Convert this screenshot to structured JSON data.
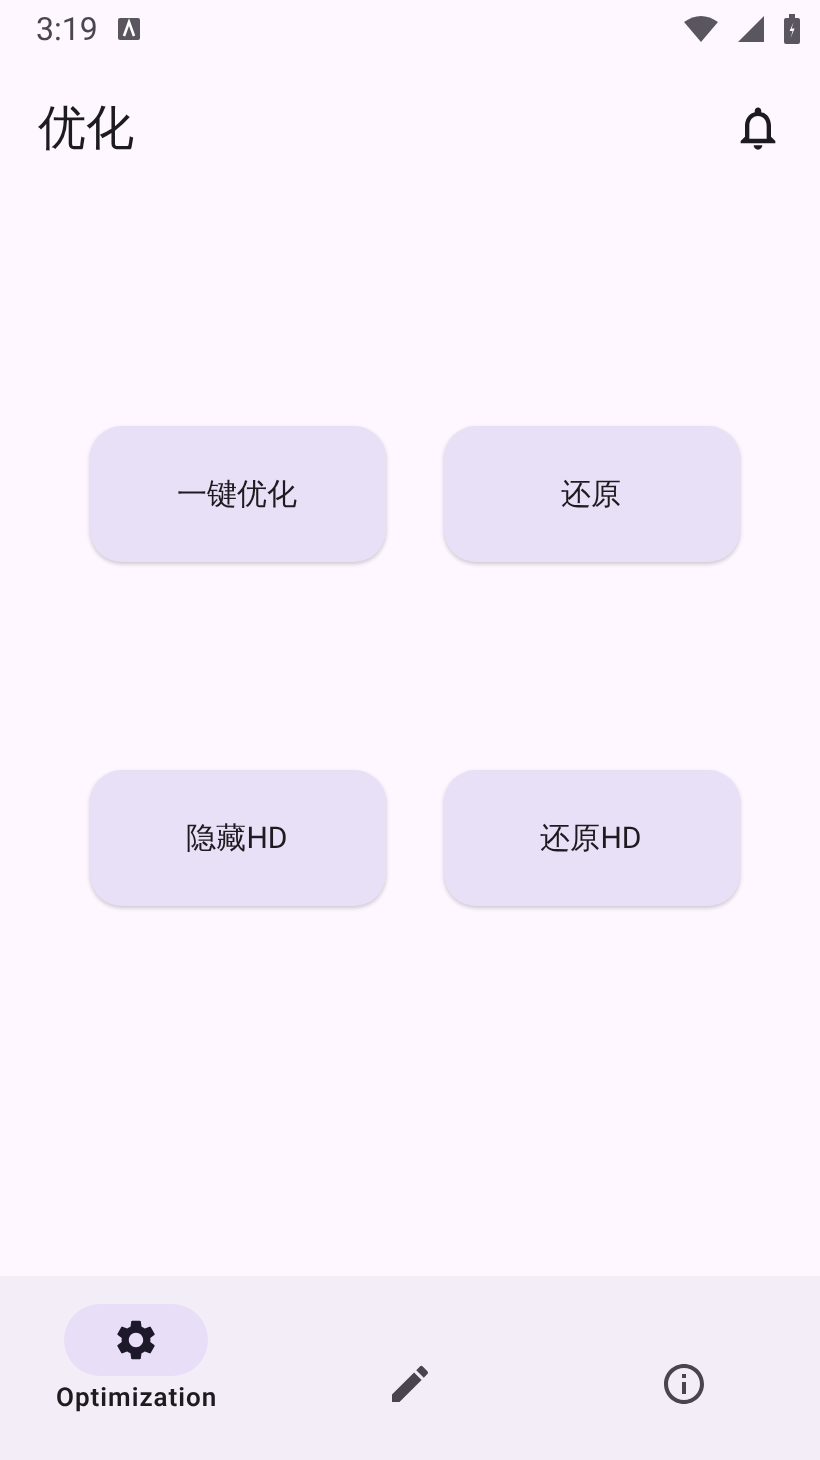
{
  "status_bar": {
    "time": "3:19"
  },
  "app_bar": {
    "title": "优化"
  },
  "buttons": [
    {
      "label": "一键优化"
    },
    {
      "label": "还原"
    },
    {
      "label": "隐藏HD"
    },
    {
      "label": "还原HD"
    }
  ],
  "nav": [
    {
      "kind": "gear",
      "label": "Optimization",
      "selected": true
    },
    {
      "kind": "pencil",
      "selected": false
    },
    {
      "kind": "info",
      "selected": false
    }
  ]
}
